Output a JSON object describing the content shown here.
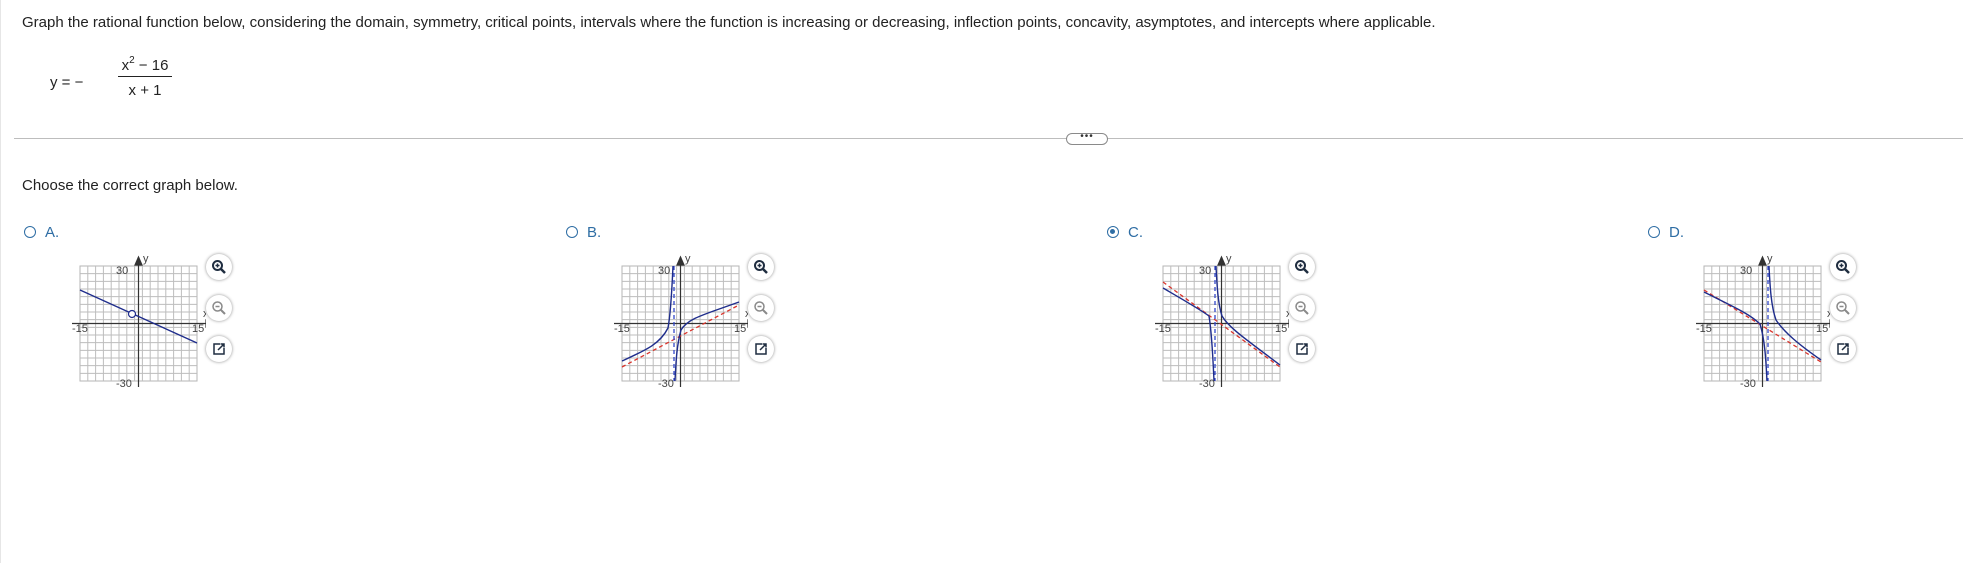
{
  "question": {
    "instructions": "Graph the rational function below, considering the domain, symmetry, critical points, intervals where the function is increasing or decreasing, inflection points, concavity, asymptotes, and intercepts where applicable.",
    "equation": {
      "lhs": "y = −",
      "numerator_base": "x",
      "numerator_exp": "2",
      "numerator_rest": " − 16",
      "denominator": "x + 1"
    }
  },
  "more_button": "•••",
  "prompt": "Choose the correct graph below.",
  "options": [
    {
      "label": "A.",
      "selected": false
    },
    {
      "label": "B.",
      "selected": false
    },
    {
      "label": "C.",
      "selected": true
    },
    {
      "label": "D.",
      "selected": false
    }
  ],
  "graph_labels": {
    "y_axis": "y",
    "x_axis": "x",
    "y_max": "30",
    "y_min": "-30",
    "x_min": "-15",
    "x_max": "15"
  },
  "tools": [
    "zoom-in-icon",
    "zoom-out-icon",
    "open-external-icon"
  ],
  "colors": {
    "accent": "#2e6da4",
    "curve": "#1f2d8c",
    "asymptote_vertical": "#3349c9",
    "asymptote_oblique": "#d9342b",
    "grid": "#b5b5b5"
  }
}
